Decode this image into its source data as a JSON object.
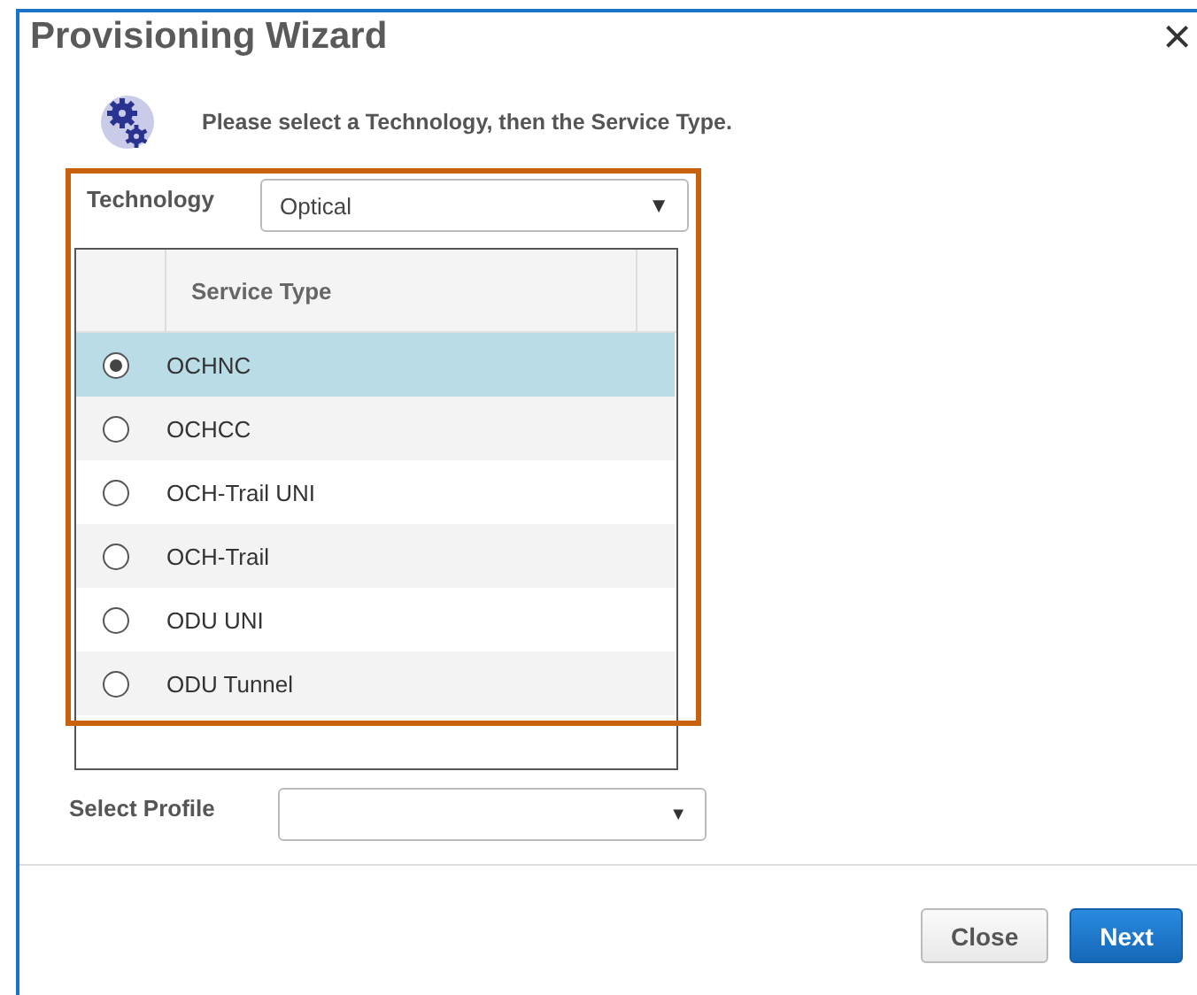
{
  "dialog": {
    "title": "Provisioning Wizard",
    "close": "×"
  },
  "message": "Please select a Technology, then the Service Type.",
  "technology": {
    "label": "Technology",
    "value": "Optical",
    "caret": "▼"
  },
  "service_table": {
    "columns": [
      "Service Type"
    ],
    "rows": [
      {
        "name": "OCHNC",
        "selected": true
      },
      {
        "name": "OCHCC",
        "selected": false
      },
      {
        "name": "OCH-Trail UNI",
        "selected": false
      },
      {
        "name": "OCH-Trail",
        "selected": false
      },
      {
        "name": "ODU UNI",
        "selected": false
      },
      {
        "name": "ODU Tunnel",
        "selected": false
      }
    ]
  },
  "profile": {
    "label": "Select Profile",
    "caret": "▼"
  },
  "buttons": [
    {
      "label": "Close",
      "kind": "secondary"
    },
    {
      "label": "Next",
      "kind": "primary"
    }
  ]
}
